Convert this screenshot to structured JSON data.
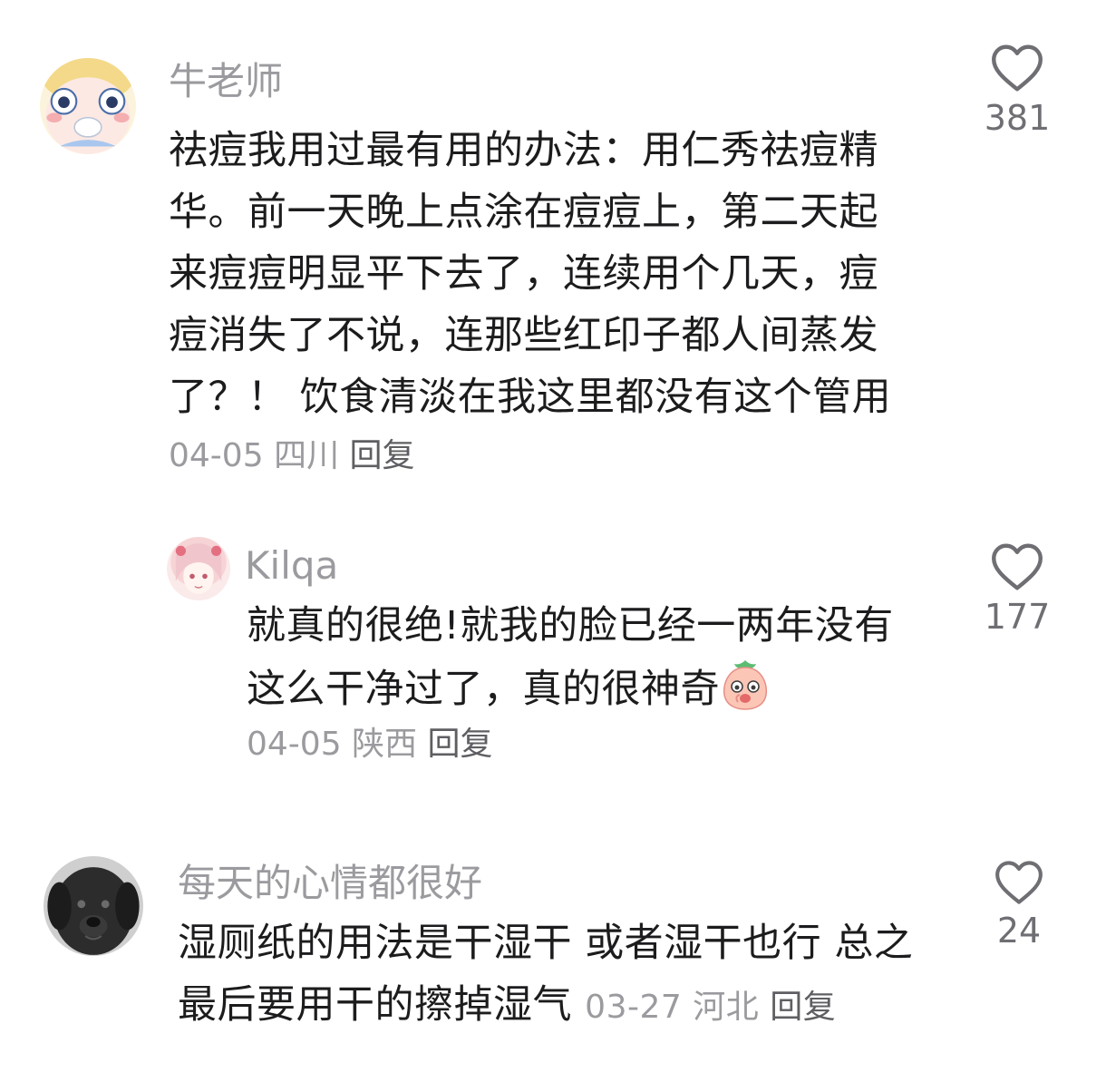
{
  "comments": [
    {
      "username": "牛老师",
      "lines": [
        "祛痘我用过最有用的办法：用仁秀祛痘精",
        "华。前一天晚上点涂在痘痘上，第二天起",
        "来痘痘明显平下去了，连续用个几天，痘",
        "痘消失了不说，连那些红印子都人间蒸发",
        "了？！ 饮食清淡在我这里都没有这个管用"
      ],
      "date": "04-05",
      "location": "四川",
      "reply_label": "回复",
      "likes": "381",
      "avatar_icon": "cartoon-baby-avatar"
    },
    {
      "username": "Kilqa",
      "lines": [
        "就真的很绝!就我的脸已经一两年没有",
        "这么干净过了，真的很神奇"
      ],
      "emoji_icon": "peach-emoji",
      "date": "04-05",
      "location": "陕西",
      "reply_label": "回复",
      "likes": "177",
      "avatar_icon": "anime-girl-avatar"
    },
    {
      "username": "每天的心情都很好",
      "lines": [
        "湿厕纸的用法是干湿干 或者湿干也行 总之",
        "最后要用干的擦掉湿气"
      ],
      "date": "03-27",
      "location": "河北",
      "reply_label": "回复",
      "likes": "24",
      "avatar_icon": "black-dog-avatar"
    }
  ],
  "colors": {
    "text": "#1c1c1e",
    "muted": "#9b9b9f",
    "reply": "#5f5f63",
    "heart_stroke": "#6e6e73"
  }
}
